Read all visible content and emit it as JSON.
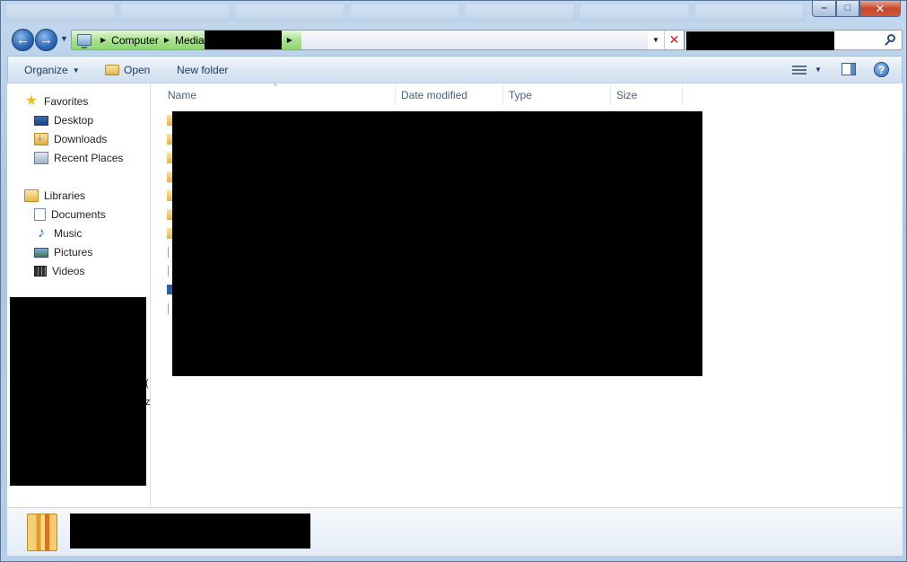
{
  "window": {
    "controls": {
      "minimize": "–",
      "maximize": "□",
      "close": "✕"
    }
  },
  "navigation": {
    "back_glyph": "←",
    "forward_glyph": "→",
    "recent_glyph": "▼",
    "breadcrumb": [
      "Computer",
      "Media"
    ],
    "separator": "▶",
    "dropdown_glyph": "▼",
    "stop_glyph": "✕"
  },
  "toolbar": {
    "organize": "Organize",
    "open": "Open",
    "new_folder": "New folder",
    "caret": "▼",
    "help": "?"
  },
  "sidebar": {
    "favorites_label": "Favorites",
    "favorites": [
      "Desktop",
      "Downloads",
      "Recent Places"
    ],
    "libraries_label": "Libraries",
    "libraries": [
      "Documents",
      "Music",
      "Pictures",
      "Videos"
    ],
    "stubs": [
      "(",
      "z"
    ]
  },
  "file_list": {
    "sort_glyph": "^",
    "columns": [
      "Name",
      "Date modified",
      "Type",
      "Size"
    ]
  },
  "icons": {
    "favorites": "star-icon",
    "desktop": "desktop-icon",
    "downloads": "downloads-icon",
    "recent": "recent-places-icon",
    "libraries": "libraries-icon",
    "documents": "documents-icon",
    "music": "music-icon",
    "pictures": "pictures-icon",
    "videos": "videos-icon"
  },
  "colors": {
    "frame": "#b9d1ea",
    "breadcrumb_progress": "#8cd76d",
    "text": "#1e395b"
  }
}
